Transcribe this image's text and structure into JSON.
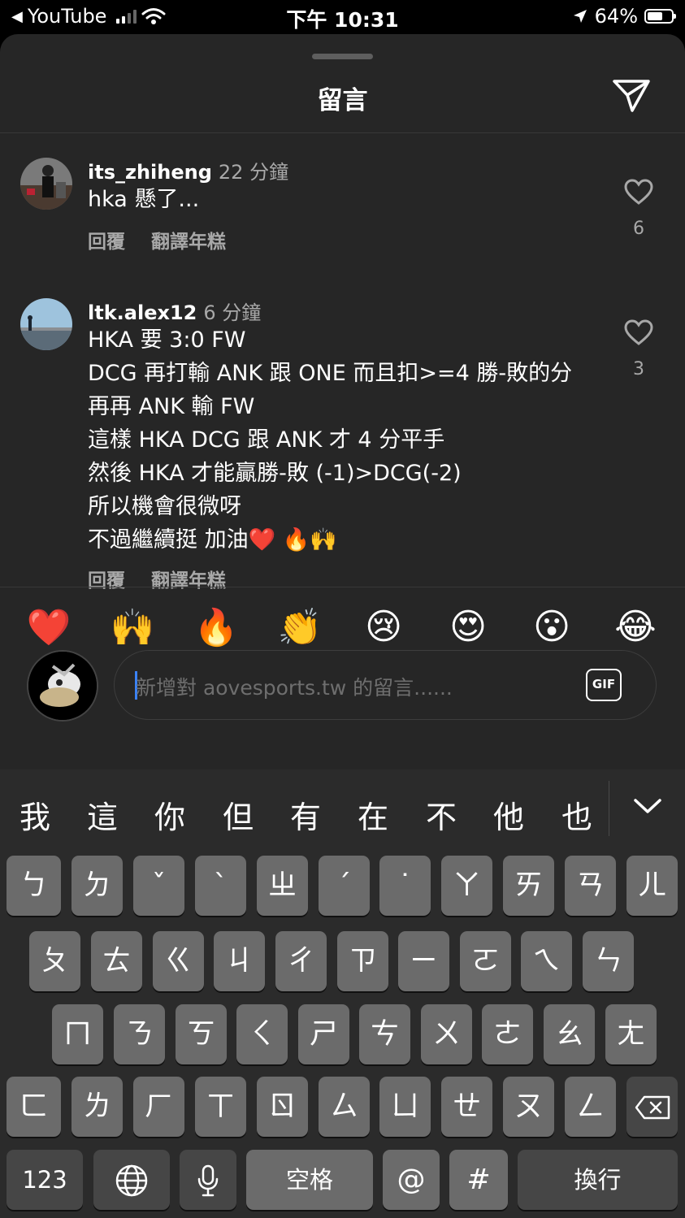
{
  "status_bar": {
    "back_app": "YouTube",
    "time": "下午 10:31",
    "battery": "64%",
    "battery_level": 0.64
  },
  "sheet": {
    "title": "留言"
  },
  "comments": [
    {
      "username": "its_zhiheng",
      "time": "22 分鐘",
      "lines": [
        "hka 懸了..."
      ],
      "reply_label": "回覆",
      "translate_label": "翻譯年糕",
      "likes": "6"
    },
    {
      "username": "ltk.alex12",
      "time": "6 分鐘",
      "lines": [
        "HKA 要 3:0 FW",
        "DCG 再打輸 ANK 跟 ONE 而且扣>=4 勝-敗的分",
        "再再 ANK 輸 FW",
        "這樣 HKA DCG 跟 ANK 才 4 分平手",
        "然後 HKA 才能贏勝-敗 (-1)>DCG(-2)",
        "所以機會很微呀",
        "不過繼續挺 加油❤️ 🔥🙌"
      ],
      "reply_label": "回覆",
      "translate_label": "翻譯年糕",
      "likes": "3"
    }
  ],
  "emoji_reactions": [
    "❤️",
    "🙌",
    "🔥",
    "👏",
    "😢",
    "😍",
    "😮",
    "😂"
  ],
  "composer": {
    "placeholder": "新增對 aovesports.tw 的留言......",
    "gif_label": "GIF"
  },
  "keyboard": {
    "candidates": [
      "我",
      "這",
      "你",
      "但",
      "有",
      "在",
      "不",
      "他",
      "也"
    ],
    "row1": [
      "ㄅ",
      "ㄉ",
      "ˇ",
      "ˋ",
      "ㄓ",
      "ˊ",
      "˙",
      "ㄚ",
      "ㄞ",
      "ㄢ",
      "ㄦ"
    ],
    "row2": [
      "ㄆ",
      "ㄊ",
      "ㄍ",
      "ㄐ",
      "ㄔ",
      "ㄗ",
      "ㄧ",
      "ㄛ",
      "ㄟ",
      "ㄣ"
    ],
    "row3": [
      "ㄇ",
      "ㄋ",
      "ㄎ",
      "ㄑ",
      "ㄕ",
      "ㄘ",
      "ㄨ",
      "ㄜ",
      "ㄠ",
      "ㄤ"
    ],
    "row4": [
      "ㄈ",
      "ㄌ",
      "ㄏ",
      "ㄒ",
      "ㄖ",
      "ㄙ",
      "ㄩ",
      "ㄝ",
      "ㄡ",
      "ㄥ"
    ],
    "numbers_label": "123",
    "space_label": "空格",
    "at_label": "@",
    "hash_label": "#",
    "return_label": "換行"
  }
}
